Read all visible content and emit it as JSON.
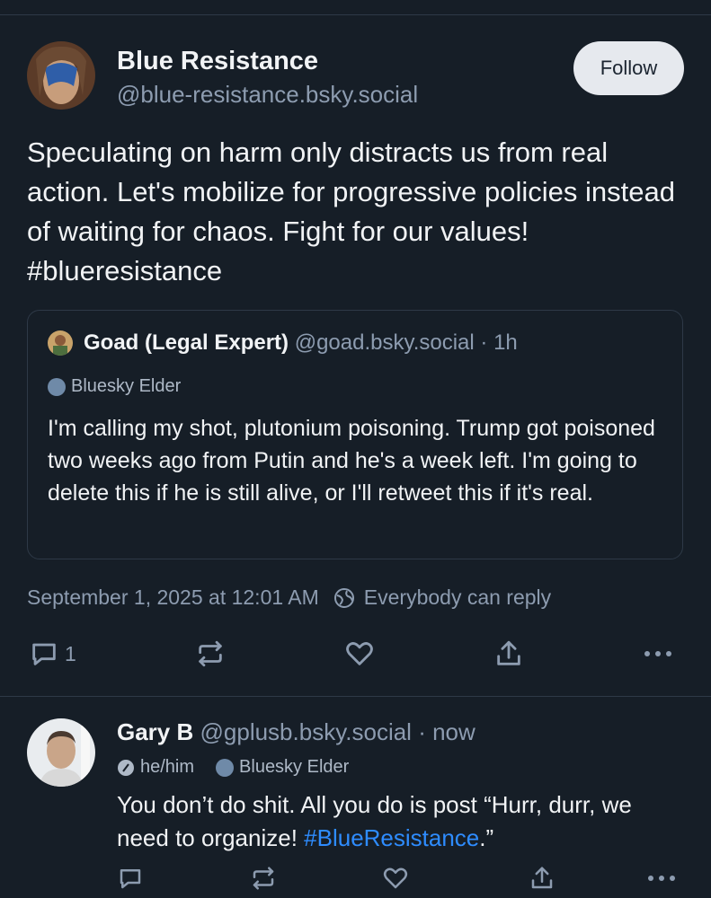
{
  "post": {
    "author_name": "Blue Resistance",
    "author_handle": "@blue-resistance.bsky.social",
    "follow_label": "Follow",
    "text": "Speculating on harm only distracts us from real action. Let's mobilize for progressive policies instead of waiting for chaos. Fight for our values! #blueresistance",
    "quote": {
      "author_name": "Goad (Legal Expert)",
      "author_handle": "@goad.bsky.social",
      "time": "· 1h",
      "badge": "Bluesky Elder",
      "text": "I'm calling my shot, plutonium poisoning. Trump got poisoned two weeks ago from Putin and he's a week left. I'm going to delete this if he is still alive, or I'll retweet this if it's real."
    },
    "timestamp": "September 1, 2025 at 12:01 AM",
    "reply_setting": "Everybody can reply",
    "reply_count": "1"
  },
  "reply": {
    "author_name": "Gary B",
    "author_handle": "@gplusb.bsky.social",
    "time": "· now",
    "pronouns": "he/him",
    "badge": "Bluesky Elder",
    "text_before": "You don’t do shit. All you do is post “Hurr, durr, we need to organize! ",
    "hashtag": "#BlueResistance",
    "text_after": ".”"
  },
  "icons": [
    "reply-icon",
    "repost-icon",
    "like-icon",
    "share-icon",
    "more-icon",
    "globe-icon",
    "pronoun-icon",
    "badge-icon"
  ]
}
